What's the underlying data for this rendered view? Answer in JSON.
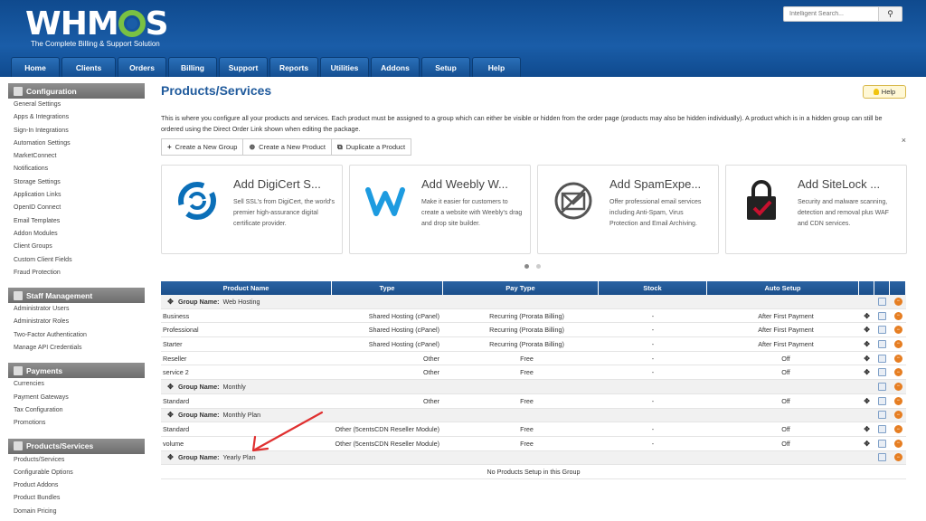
{
  "header": {
    "logo_text": "WHM",
    "logo_suffix": "S",
    "tagline": "The Complete Billing & Support Solution",
    "search_placeholder": "Intelligent Search...",
    "search_icon": "search-icon",
    "nav": [
      "Home",
      "Clients",
      "Orders",
      "Billing",
      "Support",
      "Reports",
      "Utilities",
      "Addons",
      "Setup",
      "Help"
    ]
  },
  "sidebar": {
    "sections": [
      {
        "title": "Configuration",
        "icon": "config-icon",
        "items": [
          "General Settings",
          "Apps & Integrations",
          "Sign-In Integrations",
          "Automation Settings",
          "MarketConnect",
          "Notifications",
          "Storage Settings",
          "Application Links",
          "OpenID Connect",
          "Email Templates",
          "Addon Modules",
          "Client Groups",
          "Custom Client Fields",
          "Fraud Protection"
        ]
      },
      {
        "title": "Staff Management",
        "icon": "staff-icon",
        "items": [
          "Administrator Users",
          "Administrator Roles",
          "Two-Factor Authentication",
          "Manage API Credentials"
        ]
      },
      {
        "title": "Payments",
        "icon": "payments-icon",
        "items": [
          "Currencies",
          "Payment Gateways",
          "Tax Configuration",
          "Promotions"
        ]
      },
      {
        "title": "Products/Services",
        "icon": "products-icon",
        "items": [
          "Products/Services",
          "Configurable Options",
          "Product Addons",
          "Product Bundles",
          "Domain Pricing"
        ]
      }
    ]
  },
  "main": {
    "title": "Products/Services",
    "help_label": "Help",
    "intro": "This is where you configure all your products and services. Each product must be assigned to a group which can either be visible or hidden from the order page (products may also be hidden individually). A product which is in a hidden group can still be ordered using the Direct Order Link shown when editing the package.",
    "buttons": [
      {
        "icon": "+",
        "label": "Create a New Group"
      },
      {
        "icon": "⊕",
        "label": "Create a New Product"
      },
      {
        "icon": "⧉",
        "label": "Duplicate a Product"
      }
    ],
    "close_label": "×",
    "cards": [
      {
        "title": "Add DigiCert S...",
        "desc": "Sell SSL's from DigiCert, the world's premier high-assurance digital certificate provider.",
        "icon": "digicert-icon",
        "color": "#0b6fb8"
      },
      {
        "title": "Add Weebly W...",
        "desc": "Make it easier for customers to create a website with Weebly's drag and drop site builder.",
        "icon": "weebly-icon",
        "color": "#1d9be0"
      },
      {
        "title": "Add SpamExpe...",
        "desc": "Offer professional email services including Anti-Spam, Virus Protection and Email Archiving.",
        "icon": "spamexperts-icon",
        "color": "#555555"
      },
      {
        "title": "Add SiteLock ...",
        "desc": "Security and malware scanning, detection and removal plus WAF and CDN services.",
        "icon": "sitelock-icon",
        "color": "#c8102e"
      }
    ]
  },
  "table": {
    "headers": [
      "Product Name",
      "Type",
      "Pay Type",
      "Stock",
      "Auto Setup"
    ],
    "group_label": "Group Name:",
    "empty_message": "No Products Setup in this Group",
    "groups": [
      {
        "name": "Web Hosting",
        "rows": [
          {
            "name": "Business",
            "type": "Shared Hosting (cPanel)",
            "pay": "Recurring (Prorata Billing)",
            "stock": "-",
            "auto": "After First Payment"
          },
          {
            "name": "Professional",
            "type": "Shared Hosting (cPanel)",
            "pay": "Recurring (Prorata Billing)",
            "stock": "-",
            "auto": "After First Payment"
          },
          {
            "name": "Starter",
            "type": "Shared Hosting (cPanel)",
            "pay": "Recurring (Prorata Billing)",
            "stock": "-",
            "auto": "After First Payment"
          },
          {
            "name": "Reseller",
            "type": "Other",
            "pay": "Free",
            "stock": "-",
            "auto": "Off"
          },
          {
            "name": "service 2",
            "type": "Other",
            "pay": "Free",
            "stock": "-",
            "auto": "Off"
          }
        ]
      },
      {
        "name": "Monthly",
        "rows": [
          {
            "name": "Standard",
            "type": "Other",
            "pay": "Free",
            "stock": "-",
            "auto": "Off"
          }
        ]
      },
      {
        "name": "Monthly Plan",
        "rows": [
          {
            "name": "Standard",
            "type": "Other (5centsCDN Reseller Module)",
            "pay": "Free",
            "stock": "-",
            "auto": "Off"
          },
          {
            "name": "volume",
            "type": "Other (5centsCDN Reseller Module)",
            "pay": "Free",
            "stock": "-",
            "auto": "Off"
          }
        ]
      },
      {
        "name": "Yearly Plan",
        "rows": []
      }
    ]
  },
  "colors": {
    "header_blue": "#1a5da8",
    "title_blue": "#1f5a9c",
    "annotation_red": "#e03030",
    "logo_green": "#7ac143"
  }
}
